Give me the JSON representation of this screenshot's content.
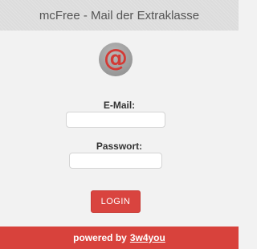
{
  "header": {
    "title": "mcFree - Mail der Extraklasse"
  },
  "logo": {
    "symbol": "@",
    "accent_color": "#d33a35",
    "background_color": "#9d9d9d"
  },
  "form": {
    "email_label": "E-Mail:",
    "email_value": "",
    "password_label": "Passwort:",
    "password_value": "",
    "login_label": "LOGIN"
  },
  "footer": {
    "text": "powered by",
    "link_text": "3w4you",
    "color": "#d8423c"
  }
}
